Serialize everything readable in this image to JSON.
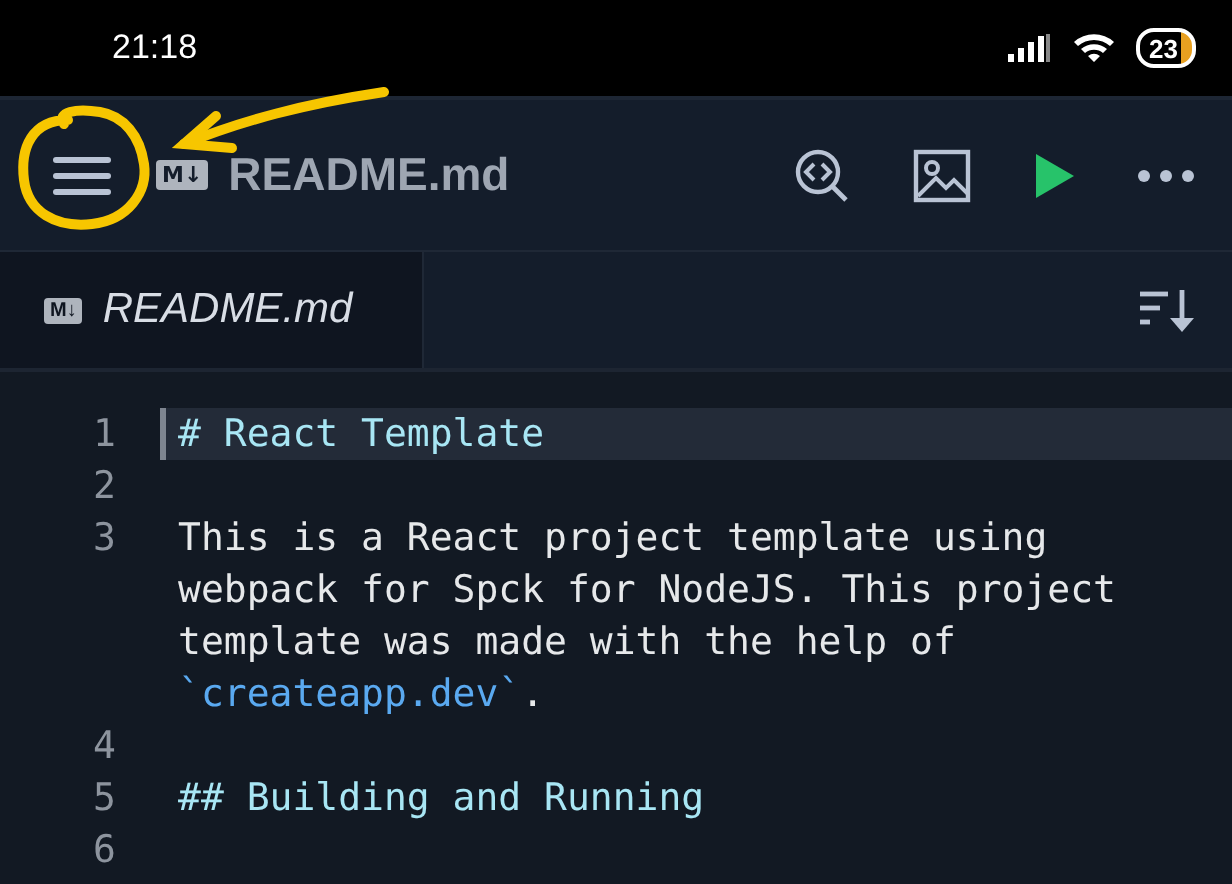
{
  "status_bar": {
    "time": "21:18",
    "battery": "23"
  },
  "toolbar": {
    "title": "README.md",
    "badge": "M↓"
  },
  "tabs": [
    {
      "label": "README.md",
      "badge": "M↓",
      "selected": true
    }
  ],
  "editor": {
    "lines": [
      {
        "number": "1",
        "current": true,
        "segments": [
          {
            "kind": "heading",
            "text": "# React Template"
          }
        ]
      },
      {
        "number": "2",
        "current": false
      },
      {
        "number": "3",
        "current": false,
        "segments": [
          {
            "kind": "text",
            "text": "This is a React project template using webpack for Spck for NodeJS. This project template was made with the help of "
          },
          {
            "kind": "code",
            "text": "`createapp.dev`"
          },
          {
            "kind": "text",
            "text": "."
          }
        ]
      },
      {
        "number": "4",
        "current": false
      },
      {
        "number": "5",
        "current": false,
        "segments": [
          {
            "kind": "heading",
            "text": "## Building and Running"
          }
        ]
      },
      {
        "number": "6",
        "current": false
      }
    ]
  }
}
